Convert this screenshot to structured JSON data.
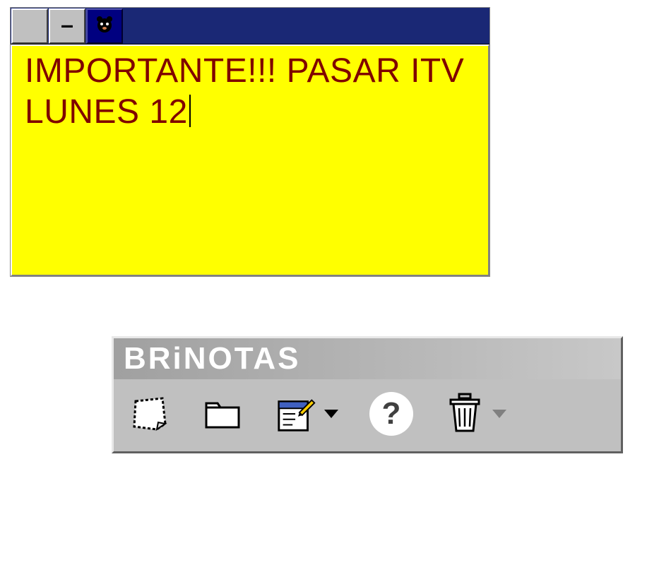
{
  "sticky_note": {
    "text": "IMPORTANTE!!! PASAR ITV LUNES 12"
  },
  "toolbar": {
    "title": "BRiNOTAS",
    "help_label": "?"
  }
}
